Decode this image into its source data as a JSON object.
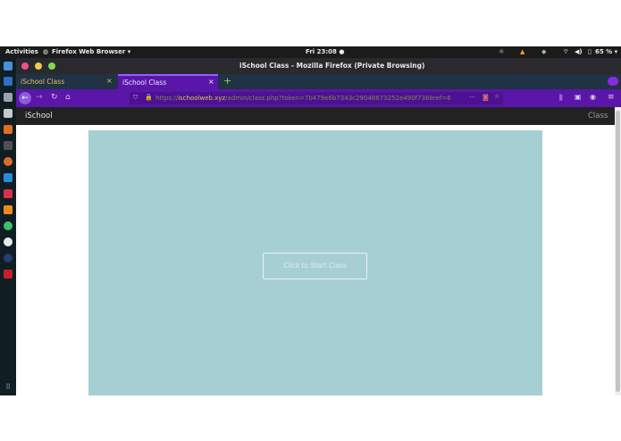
{
  "topbar": {
    "activities": "Activities",
    "app_menu": "Firefox Web Browser ▾",
    "clock": "Fri 23:08 ●",
    "battery": "65 % ▾"
  },
  "window": {
    "title": "iSchool Class - Mozilla Firefox (Private Browsing)"
  },
  "tabs": [
    {
      "label": "iSchool Class",
      "close": "×"
    },
    {
      "label": "iSchool Class",
      "close": "×"
    }
  ],
  "new_tab": "+",
  "nav": {
    "url": "https://ischoolweb.xyz/admin/class.php?token=7b479e6b7343c29048673252e490f7368ref=6",
    "more": "···"
  },
  "site": {
    "brand": "iSchool",
    "nav_item": "Class"
  },
  "main": {
    "start_label": "Click to Start Class",
    "panel_color": "#a6cfd3"
  },
  "colors": {
    "tab_accent": "#9a5cff",
    "url_host": "#e8c35a",
    "toolbar": "#5a16a8"
  }
}
